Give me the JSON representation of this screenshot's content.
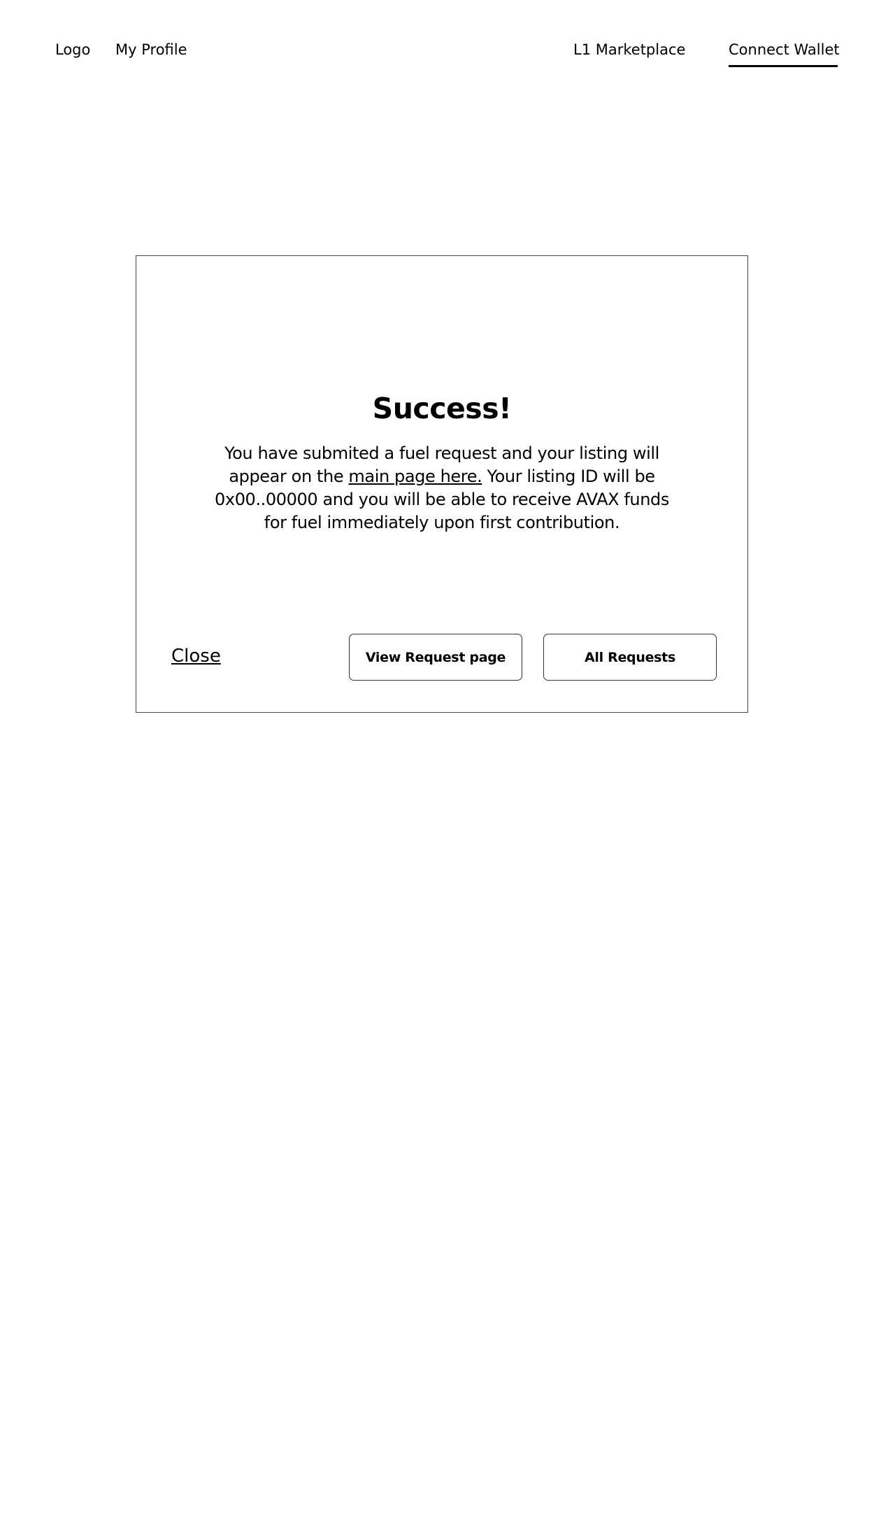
{
  "header": {
    "logo": "Logo",
    "profile": "My Profile",
    "marketplace": "L1 Marketplace",
    "connect_wallet": "Connect Wallet"
  },
  "modal": {
    "title": "Success!",
    "message_part1": "You have submited a fuel request and your listing will appear on the ",
    "message_link": "main page here.",
    "message_part2": " Your listing ID will be 0x00..00000 and you will be able to receive AVAX funds for fuel immediately upon first contribution.",
    "close_label": "Close",
    "view_request_label": "View Request page",
    "all_requests_label": "All Requests"
  }
}
